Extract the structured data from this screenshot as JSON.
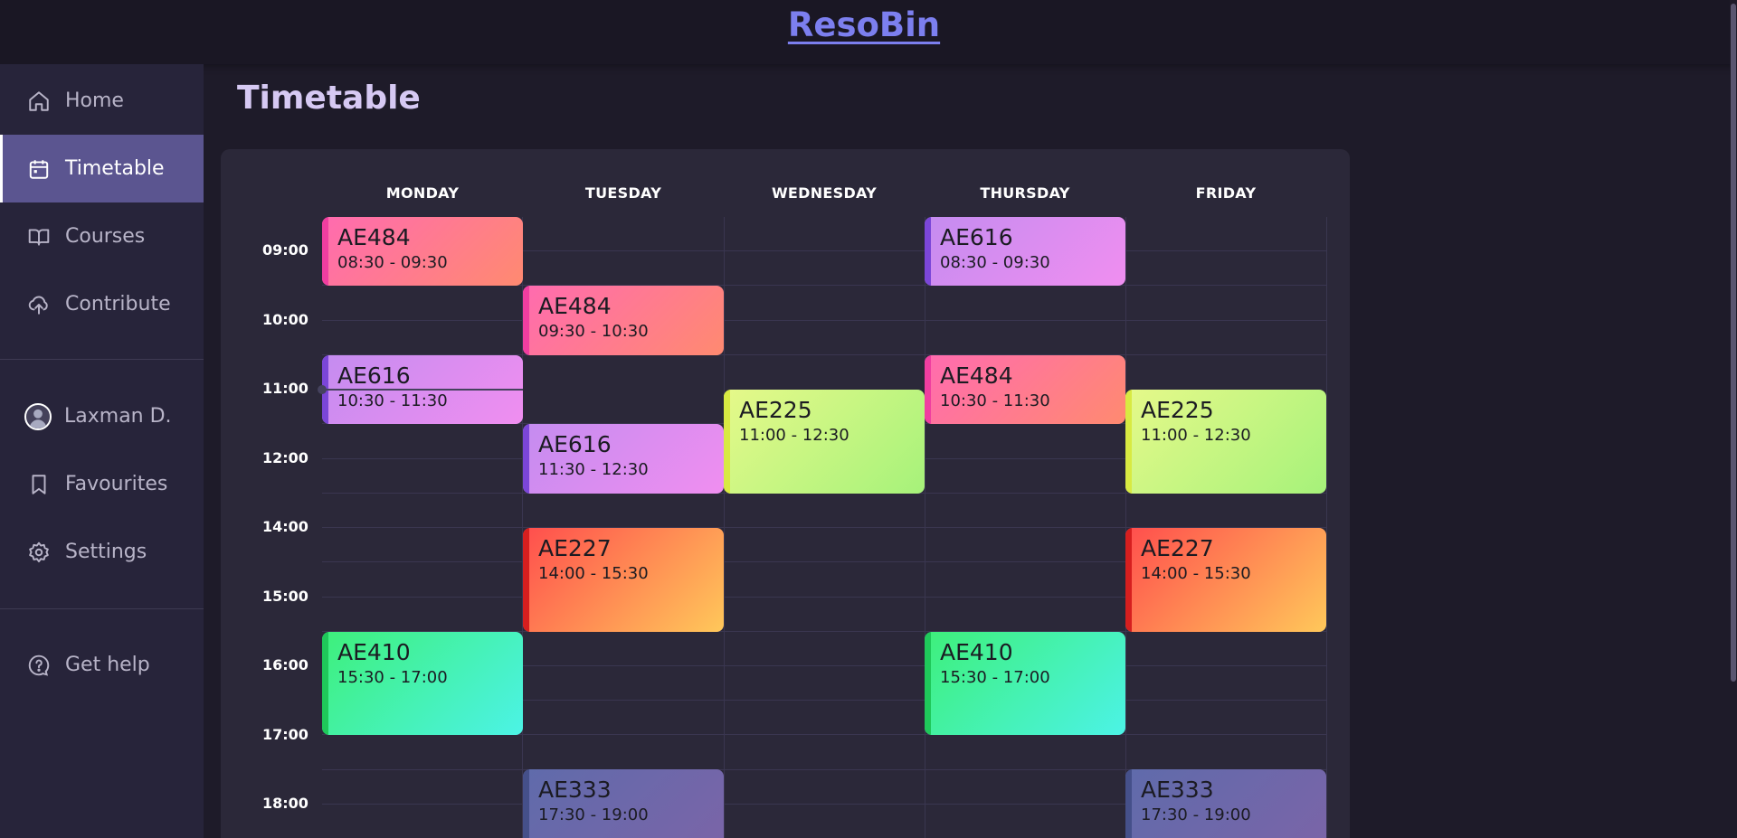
{
  "app": {
    "brand": "ResoBin"
  },
  "sidebar": {
    "items": [
      {
        "label": "Home",
        "icon": "home-icon"
      },
      {
        "label": "Timetable",
        "icon": "calendar-icon",
        "active": true
      },
      {
        "label": "Courses",
        "icon": "book-icon"
      },
      {
        "label": "Contribute",
        "icon": "upload-cloud-icon"
      }
    ],
    "user": {
      "name": "Laxman D."
    },
    "secondary": [
      {
        "label": "Favourites",
        "icon": "bookmark-icon"
      },
      {
        "label": "Settings",
        "icon": "gear-icon"
      }
    ],
    "help": {
      "label": "Get help",
      "icon": "help-icon"
    }
  },
  "page": {
    "title": "Timetable"
  },
  "timetable": {
    "days": [
      "MONDAY",
      "TUESDAY",
      "WEDNESDAY",
      "THURSDAY",
      "FRIDAY"
    ],
    "times": [
      "09:00",
      "10:00",
      "11:00",
      "12:00",
      "14:00",
      "15:00",
      "16:00",
      "17:00",
      "18:00"
    ],
    "events": [
      {
        "code": "AE484",
        "time": "08:30 - 09:30"
      },
      {
        "code": "AE616",
        "time": "10:30 - 11:30"
      },
      {
        "code": "AE410",
        "time": "15:30 - 17:00"
      },
      {
        "code": "AE484",
        "time": "09:30 - 10:30"
      },
      {
        "code": "AE616",
        "time": "11:30 - 12:30"
      },
      {
        "code": "AE227",
        "time": "14:00 - 15:30"
      },
      {
        "code": "AE333",
        "time": "17:30 - 19:00"
      },
      {
        "code": "AE225",
        "time": "11:00 - 12:30"
      },
      {
        "code": "AE616",
        "time": "08:30 - 09:30"
      },
      {
        "code": "AE484",
        "time": "10:30 - 11:30"
      },
      {
        "code": "AE410",
        "time": "15:30 - 17:00"
      },
      {
        "code": "AE225",
        "time": "11:00 - 12:30"
      },
      {
        "code": "AE227",
        "time": "14:00 - 15:30"
      },
      {
        "code": "AE333",
        "time": "17:30 - 19:00"
      }
    ]
  },
  "colors": {
    "accent": "#7c7fef",
    "active_nav": "#5b5590",
    "AE484": [
      "#ff6bb0",
      "#ff8a70",
      "#f03ea0"
    ],
    "AE616": [
      "#c48cf0",
      "#f08ef0",
      "#7b46d8"
    ],
    "AE225": [
      "#e6f98a",
      "#a6f27a",
      "#d8ea42"
    ],
    "AE227": [
      "#ff4d4d",
      "#ffc85a",
      "#d61f1f"
    ],
    "AE410": [
      "#3ef07a",
      "#4cf3e6",
      "#1fc85a"
    ],
    "AE333": [
      "#5f6bab",
      "#7c64a8",
      "#45508a"
    ]
  }
}
